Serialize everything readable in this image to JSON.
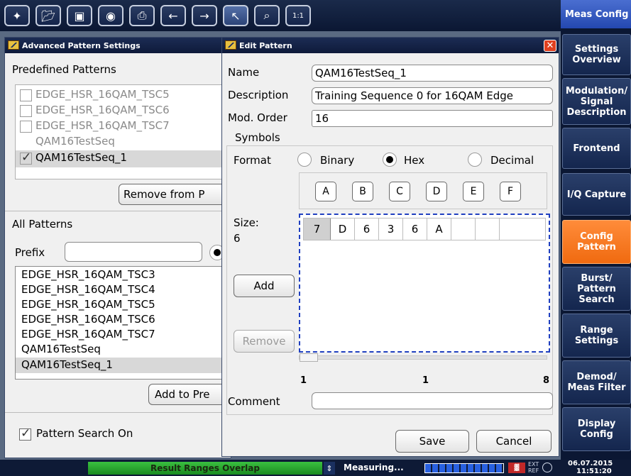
{
  "softkeys": {
    "title": "Meas Config",
    "items": [
      {
        "label": "Settings Overview",
        "active": false
      },
      {
        "label": "Modulation/ Signal Description",
        "active": false
      },
      {
        "label": "Frontend",
        "active": false
      },
      {
        "label": "I/Q Capture",
        "active": false
      },
      {
        "label": "Config Pattern",
        "active": true
      },
      {
        "label": "Burst/ Pattern Search",
        "active": false
      },
      {
        "label": "Range Settings",
        "active": false
      },
      {
        "label": "Demod/ Meas Filter",
        "active": false
      },
      {
        "label": "Display Config",
        "active": false
      }
    ]
  },
  "toolbar": {
    "buttons": [
      "preset-icon",
      "open-icon",
      "save-icon",
      "screenshot-icon",
      "print-icon",
      "undo-icon",
      "redo-icon",
      "pointer-icon",
      "zoom-icon",
      "zoom-1to1-icon"
    ],
    "zoom_one_label": "1:1"
  },
  "advanced": {
    "title": "Advanced Pattern Settings",
    "predefined_heading": "Predefined Patterns",
    "predefined": [
      {
        "name": "EDGE_HSR_16QAM_TSC5",
        "checked": false,
        "enabled": false
      },
      {
        "name": "EDGE_HSR_16QAM_TSC6",
        "checked": false,
        "enabled": false
      },
      {
        "name": "EDGE_HSR_16QAM_TSC7",
        "checked": false,
        "enabled": false
      },
      {
        "name": "QAM16TestSeq",
        "checked": false,
        "enabled": false
      },
      {
        "name": "QAM16TestSeq_1",
        "checked": true,
        "enabled": true
      }
    ],
    "remove_button": "Remove from P",
    "all_heading": "All Patterns",
    "prefix_label": "Prefix",
    "prefix_value": "",
    "all": [
      "EDGE_HSR_16QAM_TSC3",
      "EDGE_HSR_16QAM_TSC4",
      "EDGE_HSR_16QAM_TSC5",
      "EDGE_HSR_16QAM_TSC6",
      "EDGE_HSR_16QAM_TSC7",
      "QAM16TestSeq",
      "QAM16TestSeq_1"
    ],
    "add_button": "Add to Pre",
    "pattern_search_label": "Pattern Search On",
    "pattern_search_on": true
  },
  "edit": {
    "title": "Edit Pattern",
    "name_label": "Name",
    "name_value": "QAM16TestSeq_1",
    "description_label": "Description",
    "description_value": "Training Sequence 0 for 16QAM Edge",
    "modorder_label": "Mod. Order",
    "modorder_value": "16",
    "symbols_heading": "Symbols",
    "format_label": "Format",
    "formats": [
      {
        "label": "Binary",
        "selected": false
      },
      {
        "label": "Hex",
        "selected": true
      },
      {
        "label": "Decimal",
        "selected": false
      }
    ],
    "hex_buttons": [
      "A",
      "B",
      "C",
      "D",
      "E",
      "F"
    ],
    "size_label": "Size:",
    "size_value": "6",
    "symbols": [
      "7",
      "D",
      "6",
      "3",
      "6",
      "A",
      "",
      ""
    ],
    "add_button": "Add",
    "remove_button": "Remove",
    "scale_left": "1",
    "scale_mid": "1",
    "scale_right": "8",
    "comment_label": "Comment",
    "comment_value": "",
    "save_button": "Save",
    "cancel_button": "Cancel"
  },
  "status": {
    "message": "Result Ranges Overlap",
    "state": "Measuring...",
    "ext_label": "EXT",
    "ref_label": "REF",
    "date": "06.07.2015",
    "time": "11:51:20"
  }
}
